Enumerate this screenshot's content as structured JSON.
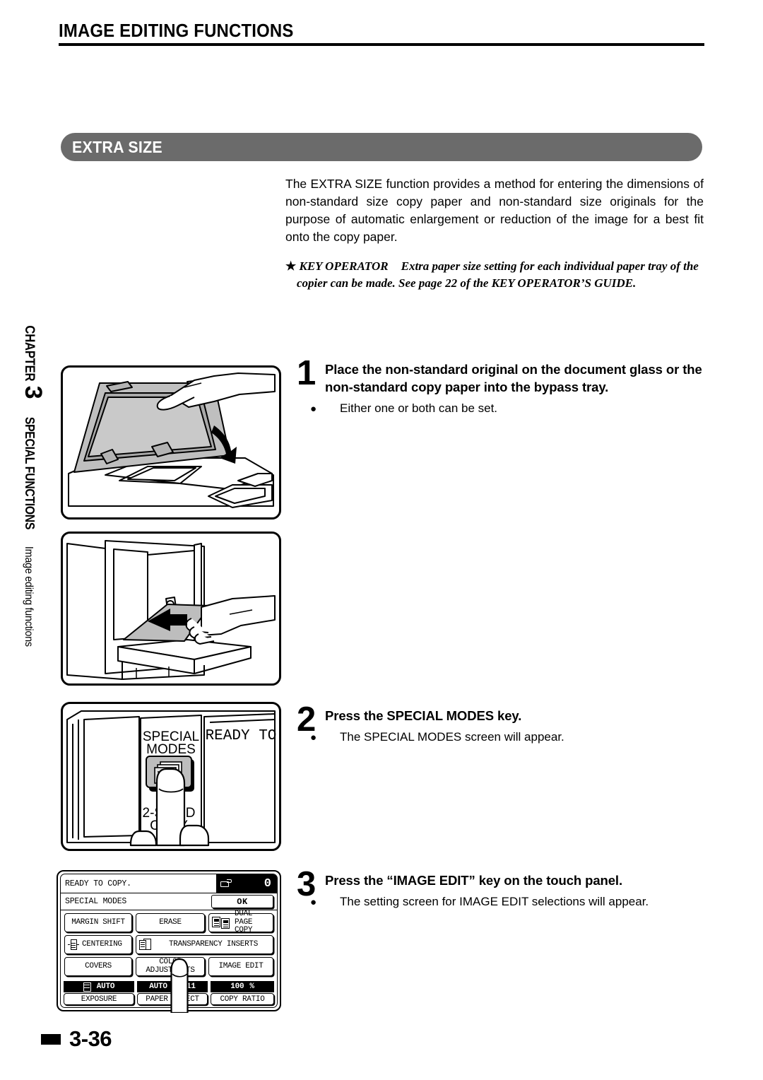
{
  "header": {
    "running_title": "IMAGE EDITING FUNCTIONS"
  },
  "section": {
    "title": "EXTRA SIZE",
    "bar_color": "#6b6b6b"
  },
  "intro": {
    "paragraph": "The EXTRA SIZE function provides a method for entering the dimensions of non-standard size copy paper and non-standard size originals for the purpose of automatic enlargement or reduction of the image for a best fit onto the copy paper.",
    "key_operator_marker": "★",
    "key_operator_label": "KEY OPERATOR",
    "key_operator_note": "Extra paper size setting for each individual paper tray of the copier can be made. See page 22 of the KEY OPERATOR’S GUIDE."
  },
  "chapter_tab": {
    "chapter_word": "CHAPTER",
    "chapter_number": "3",
    "section_name": "SPECIAL FUNCTIONS",
    "subsection_name": "Image editing functions"
  },
  "steps": [
    {
      "number": "1",
      "heading": "Place the non-standard original on the document glass or the non-standard copy paper into the bypass tray.",
      "bullet": "Either one or both can be set."
    },
    {
      "number": "2",
      "heading": "Press the SPECIAL MODES key.",
      "bullet": "The SPECIAL MODES screen will appear."
    },
    {
      "number": "3",
      "heading": "Press the “IMAGE EDIT” key on the touch panel.",
      "bullet": "The setting screen for IMAGE EDIT selections will appear."
    }
  ],
  "figures": {
    "figure_1_caption": "Copier with document cover raised, hand lowering the cover onto a non-standard original placed on the document glass",
    "figure_2_caption": "Hand inserting non-standard copy paper into the bypass tray, arrow indicating feed direction",
    "figure_3": {
      "caption": "Operation panel close-up, finger pressing the SPECIAL MODES key",
      "key_label_line1": "SPECIAL",
      "key_label_line2": "MODES",
      "display_text": "READY TO",
      "lower_key_line1": "2-SIDED",
      "lower_key_line2": "COPY"
    }
  },
  "touch_panel": {
    "status_message": "READY TO COPY.",
    "copy_count": "0",
    "tray_icon": "paper-tray-icon",
    "mode_title": "SPECIAL MODES",
    "ok_label": "OK",
    "keys": [
      [
        {
          "label": "MARGIN SHIFT",
          "icon": null
        },
        {
          "label": "ERASE",
          "icon": null
        },
        {
          "label": "DUAL PAGE\nCOPY",
          "icon": "dual-page-icon"
        }
      ],
      [
        {
          "label": "CENTERING",
          "icon": "centering-icon"
        },
        {
          "label": "TRANSPARENCY INSERTS",
          "icon": "transparency-icon"
        }
      ],
      [
        {
          "label": "COVERS",
          "icon": null
        },
        {
          "label": "COLOR\nADJUSTMENTS",
          "icon": null
        },
        {
          "label": "IMAGE EDIT",
          "icon": null
        }
      ]
    ],
    "bottom_bar": [
      {
        "value": "AUTO",
        "value_right": "",
        "label": "EXPOSURE",
        "icon": "exposure-icon"
      },
      {
        "value": "AUTO",
        "value_right": "8½x11",
        "label": "PAPER SELECT",
        "icon": null
      },
      {
        "value": "100",
        "value_right": "%",
        "label": "COPY RATIO",
        "icon": null
      }
    ]
  },
  "footer": {
    "page_number": "3-36"
  }
}
